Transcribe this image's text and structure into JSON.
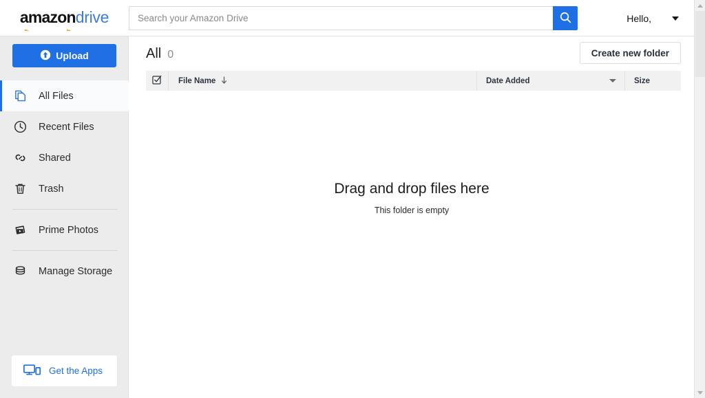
{
  "brand": {
    "name_primary": "amazon",
    "name_secondary": "drive",
    "accent_blue": "#1f6fe5",
    "logo_blue": "#3b7dd8",
    "swoosh_orange": "#f5a623"
  },
  "topbar": {
    "search": {
      "placeholder": "Search your Amazon Drive",
      "value": "",
      "button_icon": "search-icon"
    },
    "account": {
      "greeting": "Hello,",
      "caret_icon": "chevron-down-icon"
    }
  },
  "sidebar": {
    "upload": {
      "label": "Upload",
      "icon": "upload-arrow-icon"
    },
    "items": [
      {
        "label": "All Files",
        "icon": "files-copy-icon",
        "active": true
      },
      {
        "label": "Recent Files",
        "icon": "clock-icon",
        "active": false
      },
      {
        "label": "Shared",
        "icon": "link-chain-icon",
        "active": false
      },
      {
        "label": "Trash",
        "icon": "trash-icon",
        "active": false
      },
      {
        "label": "Prime Photos",
        "icon": "photo-play-icon",
        "active": false
      },
      {
        "label": "Manage Storage",
        "icon": "database-icon",
        "active": false
      }
    ],
    "get_apps": {
      "label": "Get the Apps",
      "icon": "monitor-phone-icon"
    }
  },
  "main": {
    "title": "All",
    "count": "0",
    "create_folder_label": "Create new folder",
    "table": {
      "select_all_icon": "checkbox-checked-icon",
      "columns": {
        "name": "File Name",
        "name_sort_icon": "arrow-down-icon",
        "date": "Date Added",
        "date_caret_icon": "chevron-down-icon",
        "size": "Size"
      },
      "rows": []
    },
    "empty_state": {
      "title": "Drag and drop files here",
      "subtitle": "This folder is empty"
    }
  },
  "scrollbar": {
    "up_icon": "scroll-up-arrow-icon",
    "down_icon": "scroll-down-arrow-icon"
  }
}
